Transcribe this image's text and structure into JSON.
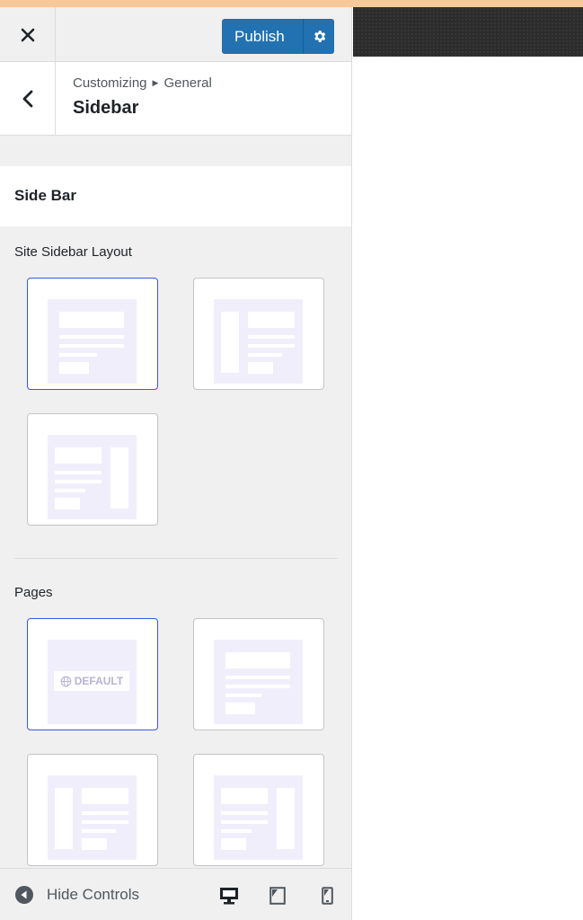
{
  "header": {
    "publish_label": "Publish"
  },
  "titlebar": {
    "breadcrumb_parent": "Customizing",
    "breadcrumb_section": "General",
    "title": "Sidebar"
  },
  "section": {
    "title": "Side Bar"
  },
  "groups": {
    "site_layout": {
      "label": "Site Sidebar Layout"
    },
    "pages": {
      "label": "Pages",
      "default_badge": "DEFAULT"
    }
  },
  "footer": {
    "hide_controls_label": "Hide Controls"
  },
  "colors": {
    "accent": "#2271b1",
    "selected_border": "#3858e9",
    "tile_canvas": "#f1eefc"
  }
}
